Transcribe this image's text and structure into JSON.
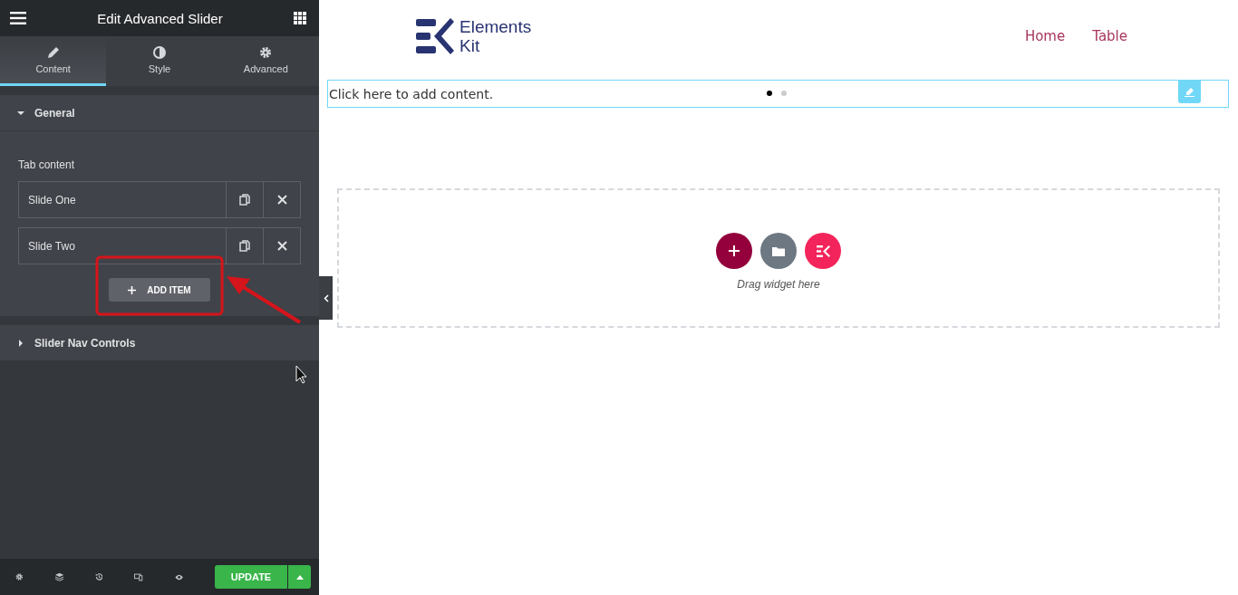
{
  "panel": {
    "title": "Edit Advanced Slider",
    "tabs": [
      {
        "label": "Content",
        "selected": true
      },
      {
        "label": "Style",
        "selected": false
      },
      {
        "label": "Advanced",
        "selected": false
      }
    ],
    "sections": [
      {
        "title": "General",
        "expanded": true,
        "field_label": "Tab content",
        "items": [
          "Slide One",
          "Slide Two"
        ],
        "add_button": "ADD ITEM"
      },
      {
        "title": "Slider Nav Controls",
        "expanded": false
      }
    ],
    "footer": {
      "update_button": "UPDATE"
    }
  },
  "page": {
    "logo": {
      "line1": "Elements",
      "line2": "Kit"
    },
    "nav": [
      "Home",
      "Table"
    ],
    "content_bar": {
      "text": "Click here to add content.",
      "dots": [
        {
          "selected": true
        },
        {
          "selected": false
        }
      ]
    },
    "drop_zone": {
      "hint": "Drag widget here"
    }
  }
}
